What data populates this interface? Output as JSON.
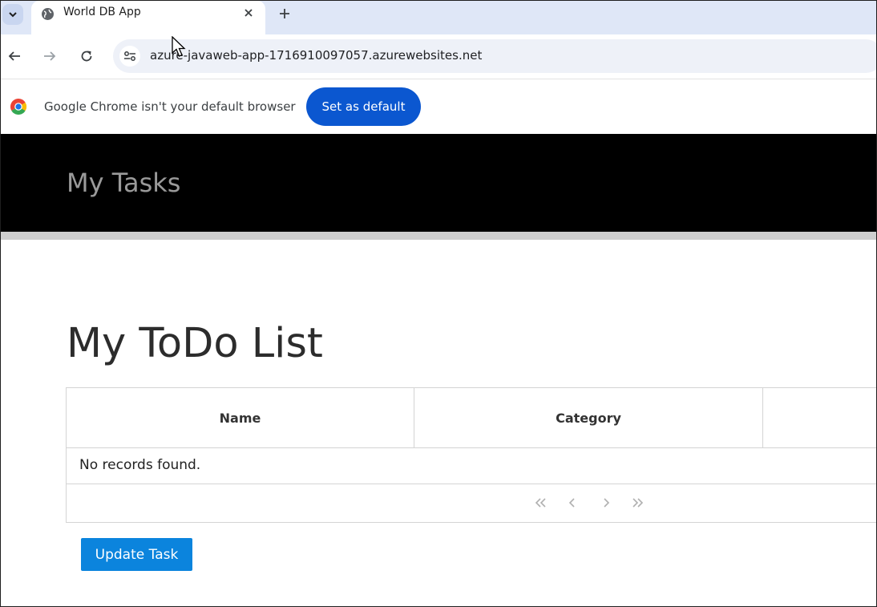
{
  "browser": {
    "tab": {
      "title": "World DB App"
    },
    "url": "azure-javaweb-app-1716910097057.azurewebsites.net",
    "infobar": {
      "message": "Google Chrome isn't your default browser",
      "button_label": "Set as default"
    },
    "colors": {
      "tabstrip": "#dfe7f7",
      "accent": "#0b57d0"
    }
  },
  "app": {
    "brand": "My Tasks",
    "page_title": "My ToDo List",
    "table": {
      "columns": [
        "Name",
        "Category",
        ""
      ],
      "empty_message": "No records found.",
      "pager": [
        "«",
        "‹",
        "›",
        "»"
      ]
    },
    "update_button": "Update Task",
    "colors": {
      "header_bg": "#000000",
      "button": "#0b84dd"
    }
  }
}
